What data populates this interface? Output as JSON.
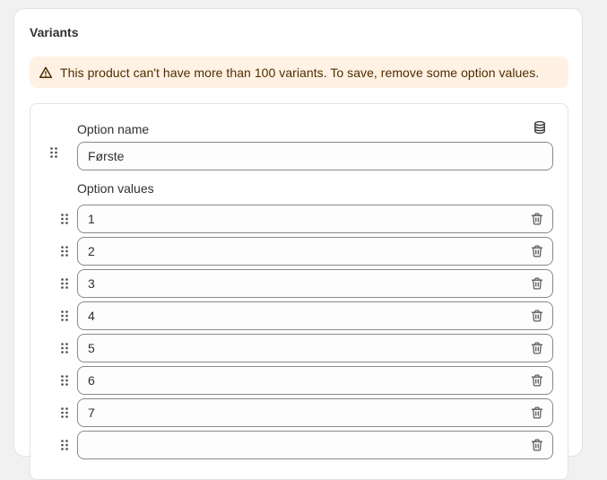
{
  "card": {
    "title": "Variants"
  },
  "banner": {
    "message": "This product can't have more than 100 variants. To save, remove some option values.",
    "icon": "warning-triangle-icon",
    "color_bg": "#fff1e3",
    "color_text": "#4f2e00"
  },
  "option": {
    "name_label": "Option name",
    "name_value": "Første",
    "values_label": "Option values",
    "values": [
      "1",
      "2",
      "3",
      "4",
      "5",
      "6",
      "7",
      ""
    ]
  }
}
